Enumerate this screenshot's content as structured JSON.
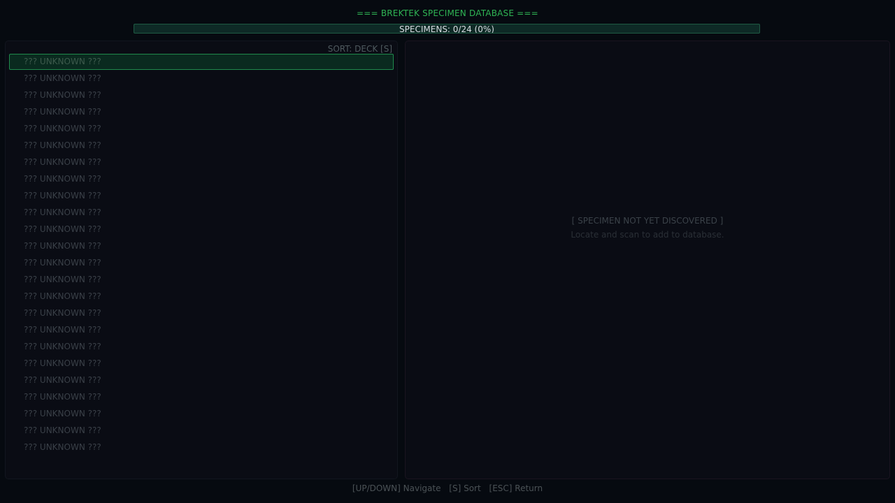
{
  "header": {
    "title": "=== BREKTEK SPECIMEN DATABASE ===",
    "progress_label": "SPECIMENS: 0/24 (0%)",
    "progress_fraction": 0
  },
  "list_panel": {
    "sort_label": "SORT: DECK [S]",
    "selected_index": 0,
    "items": [
      "??? UNKNOWN ???",
      "??? UNKNOWN ???",
      "??? UNKNOWN ???",
      "??? UNKNOWN ???",
      "??? UNKNOWN ???",
      "??? UNKNOWN ???",
      "??? UNKNOWN ???",
      "??? UNKNOWN ???",
      "??? UNKNOWN ???",
      "??? UNKNOWN ???",
      "??? UNKNOWN ???",
      "??? UNKNOWN ???",
      "??? UNKNOWN ???",
      "??? UNKNOWN ???",
      "??? UNKNOWN ???",
      "??? UNKNOWN ???",
      "??? UNKNOWN ???",
      "??? UNKNOWN ???",
      "??? UNKNOWN ???",
      "??? UNKNOWN ???",
      "??? UNKNOWN ???",
      "??? UNKNOWN ???",
      "??? UNKNOWN ???",
      "??? UNKNOWN ???"
    ]
  },
  "detail_panel": {
    "title": "[ SPECIMEN NOT YET DISCOVERED ]",
    "subtitle": "Locate and scan to add to database."
  },
  "footer": {
    "hints": [
      "[UP/DOWN] Navigate",
      "[S] Sort",
      "[ESC] Return"
    ]
  },
  "colors": {
    "accent_green": "#2fb454",
    "selection_border": "#1f8a4c",
    "background": "#060a10"
  }
}
